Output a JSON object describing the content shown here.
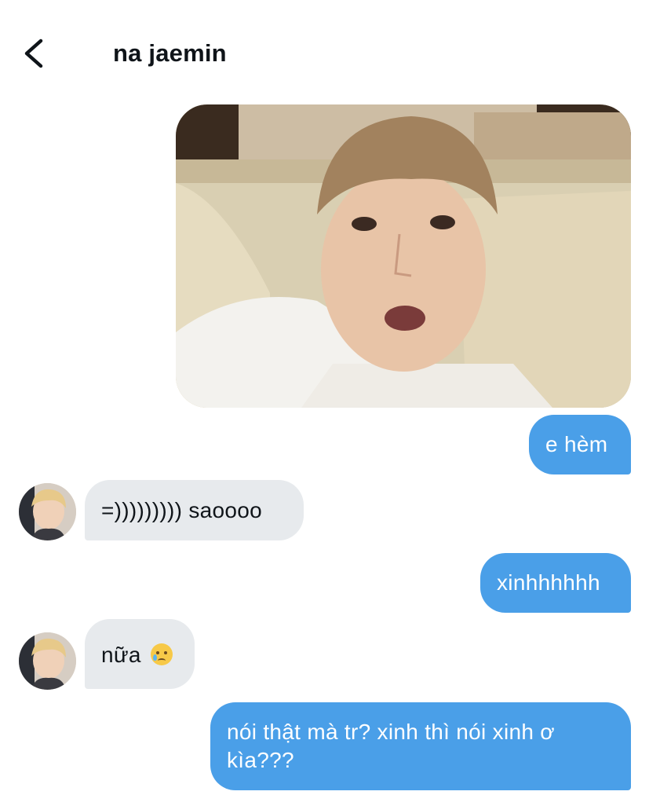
{
  "header": {
    "back_icon": "chevron-left-icon",
    "title": "na jaemin"
  },
  "messages": [
    {
      "type": "image",
      "direction": "outgoing",
      "image": "photo"
    },
    {
      "type": "text",
      "direction": "outgoing",
      "text": "e hèm"
    },
    {
      "type": "text",
      "direction": "incoming",
      "text": "=))))))))) saoooo",
      "avatar": "avatar"
    },
    {
      "type": "text",
      "direction": "outgoing",
      "text": "xinhhhhhh"
    },
    {
      "type": "text",
      "direction": "incoming",
      "text": "nữa",
      "emoji": "crying-face-icon",
      "avatar": "avatar"
    },
    {
      "type": "text",
      "direction": "outgoing",
      "text": "nói thật mà tr? xinh thì nói xinh ơ kìa???"
    }
  ],
  "colors": {
    "outgoing_bubble": "#4a9fe8",
    "incoming_bubble": "#e7eaed",
    "text_primary": "#0f1419",
    "background": "#ffffff"
  }
}
